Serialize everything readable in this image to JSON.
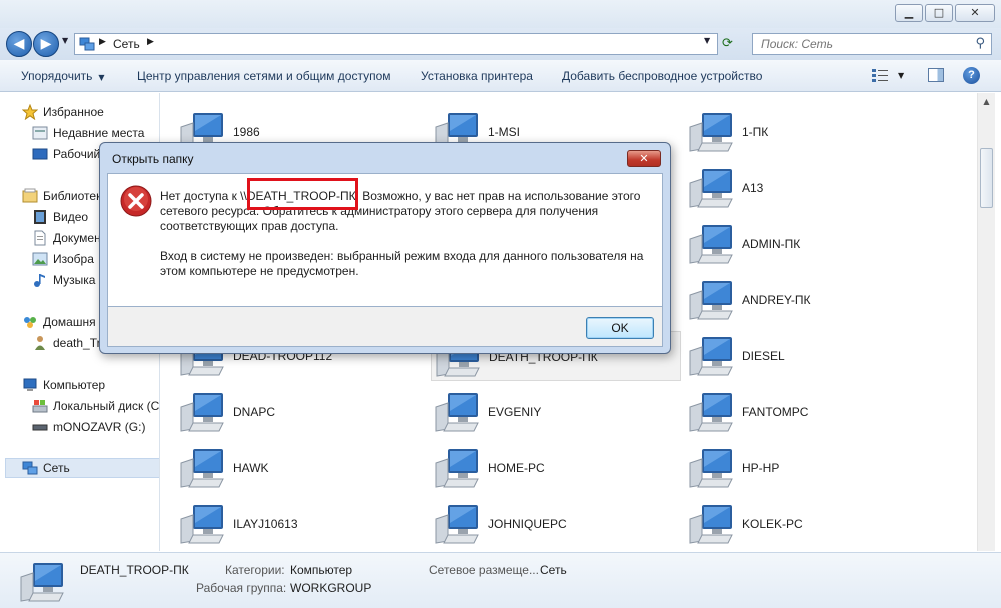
{
  "window": {
    "minimize": "▁",
    "maximize": "□",
    "close": "✕"
  },
  "address": {
    "location": "Сеть",
    "search_placeholder": "Поиск: Сеть"
  },
  "toolbar": {
    "organize": "Упорядочить",
    "network_center": "Центр управления сетями и общим доступом",
    "add_printer": "Установка принтера",
    "add_wireless": "Добавить беспроводное устройство",
    "help": "?"
  },
  "navpane": {
    "items": [
      {
        "label": "Избранное",
        "icon": "star-icon"
      },
      {
        "label": "Недавние места",
        "icon": "recent-places-icon"
      },
      {
        "label": "Рабочий",
        "icon": "desktop-icon"
      },
      {
        "label": "Библиотек",
        "icon": "libraries-icon"
      },
      {
        "label": "Видео",
        "icon": "video-icon"
      },
      {
        "label": "Докумен",
        "icon": "documents-icon"
      },
      {
        "label": "Изобра",
        "icon": "pictures-icon"
      },
      {
        "label": "Музыка",
        "icon": "music-icon"
      },
      {
        "label": "Домашня",
        "icon": "homegroup-icon"
      },
      {
        "label": "death_Tr",
        "icon": "user-icon"
      },
      {
        "label": "Компьютер",
        "icon": "computer-icon"
      },
      {
        "label": "Локальный диск (C",
        "icon": "local-disk-icon"
      },
      {
        "label": "mONOZAVR (G:)",
        "icon": "removable-drive-icon"
      },
      {
        "label": "Сеть",
        "icon": "network-icon"
      }
    ]
  },
  "computers": [
    "1986",
    "1-MSI",
    "1-ПК",
    "",
    "",
    "A13",
    "",
    "",
    "ADMIN-ПК",
    "",
    "",
    "ANDREY-ПК",
    "DEAD-TROOP112",
    "DEATH_TROOP-ПК",
    "DIESEL",
    "DNAPC",
    "EVGENIY",
    "FANTOMPC",
    "HAWK",
    "HOME-PC",
    "HP-HP",
    "ILAYJ10613",
    "JOHNIQUEPC",
    "KOLEK-PC"
  ],
  "details": {
    "name": "DEATH_TROOP-ПК",
    "categories_label": "Категории:",
    "categories_value": "Компьютер",
    "workgroup_label": "Рабочая группа:",
    "workgroup_value": "WORKGROUP",
    "location_label": "Сетевое размеще...",
    "location_value": "Сеть"
  },
  "dialog": {
    "title": "Открыть папку",
    "message1": "Нет доступа к \\\\DEATH_TROOP-ПК. Возможно, у вас нет прав на использование этого сетевого ресурса. Обратитесь к администратору этого сервера для получения соответствующих прав доступа.",
    "message2": "Вход в систему не произведен: выбранный режим входа для данного пользователя на этом компьютере не предусмотрен.",
    "ok": "OK",
    "close": "✕"
  },
  "colors": {
    "highlight": "#e0121b",
    "error": "#c62828",
    "accent": "#1f5fad"
  }
}
